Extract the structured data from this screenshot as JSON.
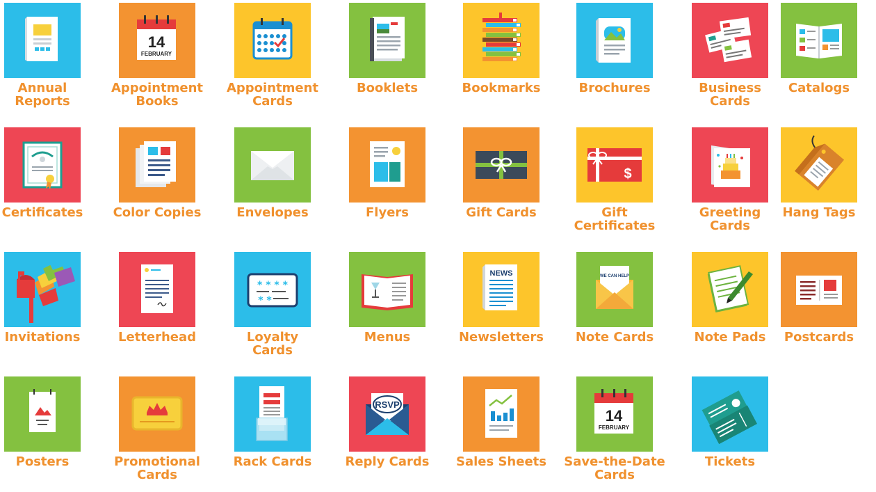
{
  "colors": {
    "blue": "#2CBDE9",
    "orange": "#F39331",
    "yellow": "#FDC52B",
    "green": "#84C140",
    "red": "#EE4654",
    "label": "#F0912E"
  },
  "products": [
    {
      "label": "Annual Reports",
      "lines": [
        "Annual",
        "Reports"
      ],
      "bg": "blue",
      "icon": "annual-report-icon"
    },
    {
      "label": "Appointment Books",
      "lines": [
        "Appointment",
        "Books"
      ],
      "bg": "orange",
      "icon": "calendar-date-icon",
      "day": "14",
      "month": "FEBRUARY"
    },
    {
      "label": "Appointment Cards",
      "lines": [
        "Appointment",
        "Cards"
      ],
      "bg": "yellow",
      "icon": "calendar-check-icon"
    },
    {
      "label": "Booklets",
      "lines": [
        "Booklets"
      ],
      "bg": "green",
      "icon": "booklet-icon"
    },
    {
      "label": "Bookmarks",
      "lines": [
        "Bookmarks"
      ],
      "bg": "yellow",
      "icon": "book-stack-icon"
    },
    {
      "label": "Brochures",
      "lines": [
        "Brochures"
      ],
      "bg": "blue",
      "icon": "brochure-icon"
    },
    {
      "label": "Business Cards",
      "lines": [
        "Business",
        "Cards"
      ],
      "bg": "red",
      "icon": "business-cards-icon"
    },
    {
      "label": "Catalogs",
      "lines": [
        "Catalogs"
      ],
      "bg": "green",
      "icon": "catalog-icon"
    },
    {
      "label": "Certificates",
      "lines": [
        "Certificates"
      ],
      "bg": "red",
      "icon": "certificate-icon"
    },
    {
      "label": "Color Copies",
      "lines": [
        "Color Copies"
      ],
      "bg": "orange",
      "icon": "color-copies-icon"
    },
    {
      "label": "Envelopes",
      "lines": [
        "Envelopes"
      ],
      "bg": "green",
      "icon": "envelope-icon"
    },
    {
      "label": "Flyers",
      "lines": [
        "Flyers"
      ],
      "bg": "orange",
      "icon": "flyer-icon"
    },
    {
      "label": "Gift Cards",
      "lines": [
        "Gift Cards"
      ],
      "bg": "orange",
      "icon": "gift-card-icon"
    },
    {
      "label": "Gift Certificates",
      "lines": [
        "Gift",
        "Certificates"
      ],
      "bg": "yellow",
      "icon": "gift-certificate-icon",
      "symbol": "$"
    },
    {
      "label": "Greeting Cards",
      "lines": [
        "Greeting",
        "Cards"
      ],
      "bg": "red",
      "icon": "greeting-card-icon"
    },
    {
      "label": "Hang Tags",
      "lines": [
        "Hang Tags"
      ],
      "bg": "yellow",
      "icon": "hang-tag-icon"
    },
    {
      "label": "Invitations",
      "lines": [
        "Invitations"
      ],
      "bg": "blue",
      "icon": "mailbox-icon"
    },
    {
      "label": "Letterhead",
      "lines": [
        "Letterhead"
      ],
      "bg": "red",
      "icon": "letterhead-icon"
    },
    {
      "label": "Loyalty Cards",
      "lines": [
        "Loyalty",
        "Cards"
      ],
      "bg": "blue",
      "icon": "loyalty-card-icon"
    },
    {
      "label": "Menus",
      "lines": [
        "Menus"
      ],
      "bg": "green",
      "icon": "menu-icon"
    },
    {
      "label": "Newsletters",
      "lines": [
        "Newsletters"
      ],
      "bg": "yellow",
      "icon": "newsletter-icon",
      "masthead": "NEWS"
    },
    {
      "label": "Note Cards",
      "lines": [
        "Note Cards"
      ],
      "bg": "green",
      "icon": "note-card-icon",
      "note": "WE CAN HELP"
    },
    {
      "label": "Note Pads",
      "lines": [
        "Note Pads"
      ],
      "bg": "yellow",
      "icon": "note-pad-icon"
    },
    {
      "label": "Postcards",
      "lines": [
        "Postcards"
      ],
      "bg": "orange",
      "icon": "postcard-icon"
    },
    {
      "label": "Posters",
      "lines": [
        "Posters"
      ],
      "bg": "green",
      "icon": "poster-icon"
    },
    {
      "label": "Promotional Cards",
      "lines": [
        "Promotional",
        "Cards"
      ],
      "bg": "orange",
      "icon": "promo-card-icon"
    },
    {
      "label": "Rack Cards",
      "lines": [
        "Rack Cards"
      ],
      "bg": "blue",
      "icon": "rack-card-icon"
    },
    {
      "label": "Reply Cards",
      "lines": [
        "Reply Cards"
      ],
      "bg": "red",
      "icon": "rsvp-icon",
      "badge": "RSVP"
    },
    {
      "label": "Sales Sheets",
      "lines": [
        "Sales Sheets"
      ],
      "bg": "orange",
      "icon": "sales-sheet-icon"
    },
    {
      "label": "Save-the-Date Cards",
      "lines": [
        "Save-the-Date",
        "Cards"
      ],
      "bg": "green",
      "icon": "calendar-date-icon",
      "day": "14",
      "month": "FEBRUARY"
    },
    {
      "label": "Tickets",
      "lines": [
        "Tickets"
      ],
      "bg": "blue",
      "icon": "ticket-icon"
    }
  ]
}
